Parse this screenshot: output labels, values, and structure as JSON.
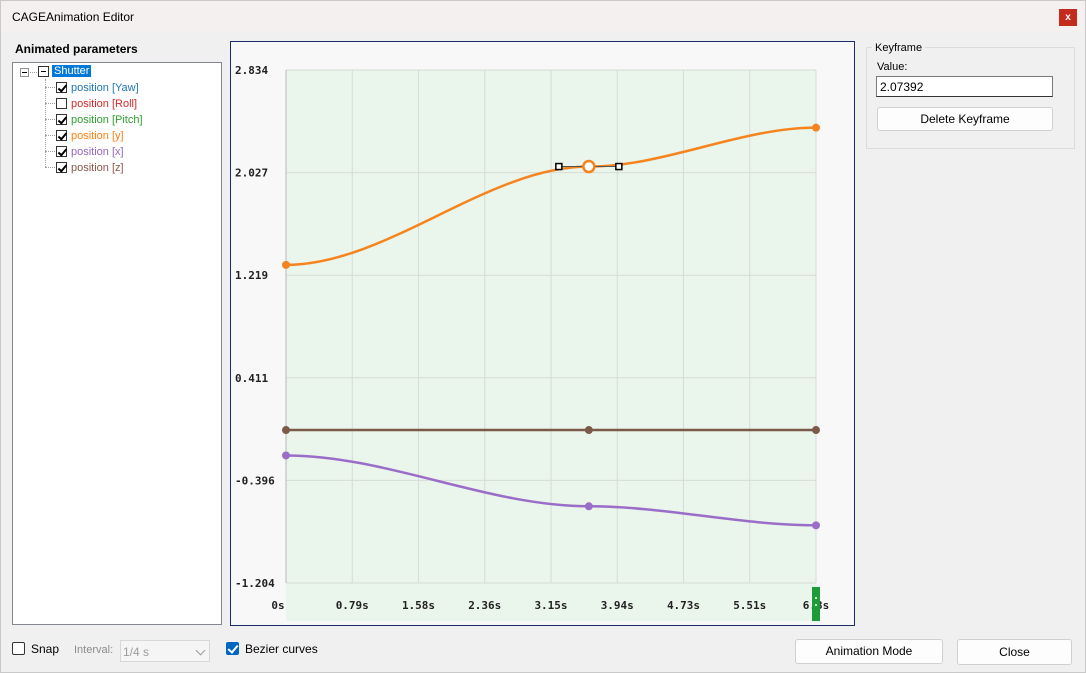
{
  "window": {
    "title": "CAGEAnimation Editor",
    "close_glyph": "x"
  },
  "params": {
    "label": "Animated parameters",
    "root": {
      "label": "Shutter"
    },
    "items": [
      {
        "label": "position [Yaw]",
        "checked": true,
        "color": "#1f77b4"
      },
      {
        "label": "position [Roll]",
        "checked": false,
        "color": "#d62728"
      },
      {
        "label": "position [Pitch]",
        "checked": true,
        "color": "#2ca02c"
      },
      {
        "label": "position [y]",
        "checked": true,
        "color": "#ff7f0e"
      },
      {
        "label": "position [x]",
        "checked": true,
        "color": "#9467bd"
      },
      {
        "label": "position [z]",
        "checked": true,
        "color": "#8c564b"
      }
    ]
  },
  "keyframe": {
    "group_title": "Keyframe",
    "value_label": "Value:",
    "value": "2.07392",
    "delete_label": "Delete Keyframe"
  },
  "bottom": {
    "snap_label": "Snap",
    "snap_checked": false,
    "interval_label": "Interval:",
    "interval_value": "1/4 s",
    "bezier_label": "Bezier curves",
    "bezier_checked": true,
    "animation_mode_label": "Animation Mode",
    "close_label": "Close"
  },
  "chart_data": {
    "type": "line",
    "ylim": [
      -1.204,
      2.834
    ],
    "xlim": [
      0,
      6.3
    ],
    "y_ticks": [
      "2.834",
      "2.027",
      "1.219",
      "0.411",
      "-0.396",
      "-1.204"
    ],
    "x_ticks": [
      "0s",
      "0.79s",
      "1.58s",
      "2.36s",
      "3.15s",
      "3.94s",
      "4.73s",
      "5.51s",
      "6.3s"
    ],
    "selected_keyframe": {
      "series": "position [y]",
      "x": 3.6,
      "y": 2.074
    },
    "series": [
      {
        "name": "position [y]",
        "color": "#f5841f",
        "points": [
          [
            0,
            1.3
          ],
          [
            3.6,
            2.074
          ],
          [
            6.3,
            2.38
          ]
        ]
      },
      {
        "name": "position [z]",
        "color": "#7b5a4a",
        "points": [
          [
            0,
            0.0
          ],
          [
            3.6,
            0.0
          ],
          [
            6.3,
            0.0
          ]
        ]
      },
      {
        "name": "position [x]",
        "color": "#9a6dc8",
        "points": [
          [
            0,
            -0.2
          ],
          [
            3.6,
            -0.6
          ],
          [
            6.3,
            -0.75
          ]
        ]
      }
    ]
  }
}
